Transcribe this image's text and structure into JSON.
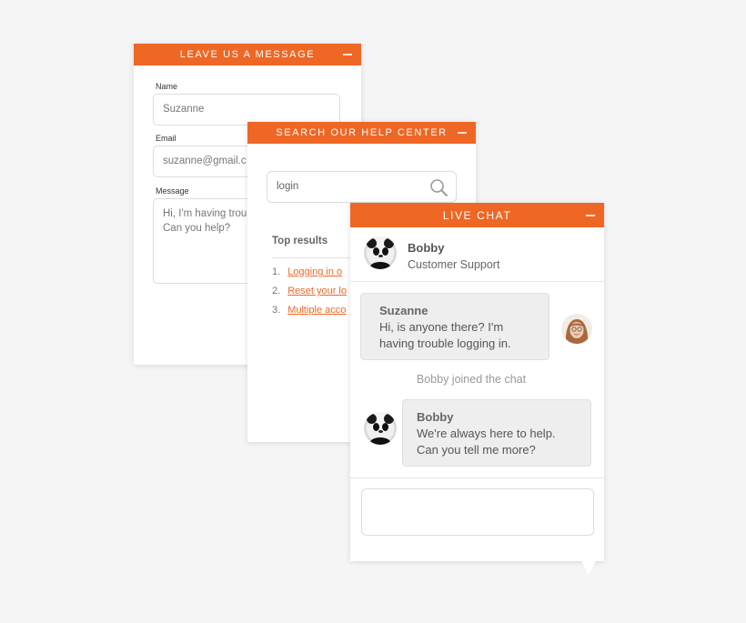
{
  "message_widget": {
    "title": "LEAVE US A MESSAGE",
    "name_label": "Name",
    "name_value": "Suzanne",
    "email_label": "Email",
    "email_value": "suzanne@gmail.c",
    "message_label": "Message",
    "message_line1": "Hi, I'm having troub",
    "message_line2": "Can you help?"
  },
  "help_widget": {
    "title": "SEARCH OUR HELP CENTER",
    "search_value": "login",
    "top_results_label": "Top results",
    "results": [
      {
        "num": "1.",
        "text": "Logging in o"
      },
      {
        "num": "2.",
        "text": "Reset your lo"
      },
      {
        "num": "3.",
        "text": "Multiple acco"
      }
    ]
  },
  "chat_widget": {
    "title": "LIVE CHAT",
    "agent_name": "Bobby",
    "agent_role": "Customer Support",
    "msg1_author": "Suzanne",
    "msg1_line1": "Hi, is anyone there? I'm",
    "msg1_line2": "having trouble logging in.",
    "system_notice": "Bobby joined the chat",
    "msg2_author": "Bobby",
    "msg2_line1": "We're always here to help.",
    "msg2_line2": "Can you tell me more?"
  },
  "colors": {
    "accent": "#ef6725",
    "background": "#f5f5f5",
    "bubble": "#eeeeee"
  },
  "icons": [
    "minimize-icon",
    "search-icon",
    "agent-avatar",
    "user-avatar"
  ]
}
